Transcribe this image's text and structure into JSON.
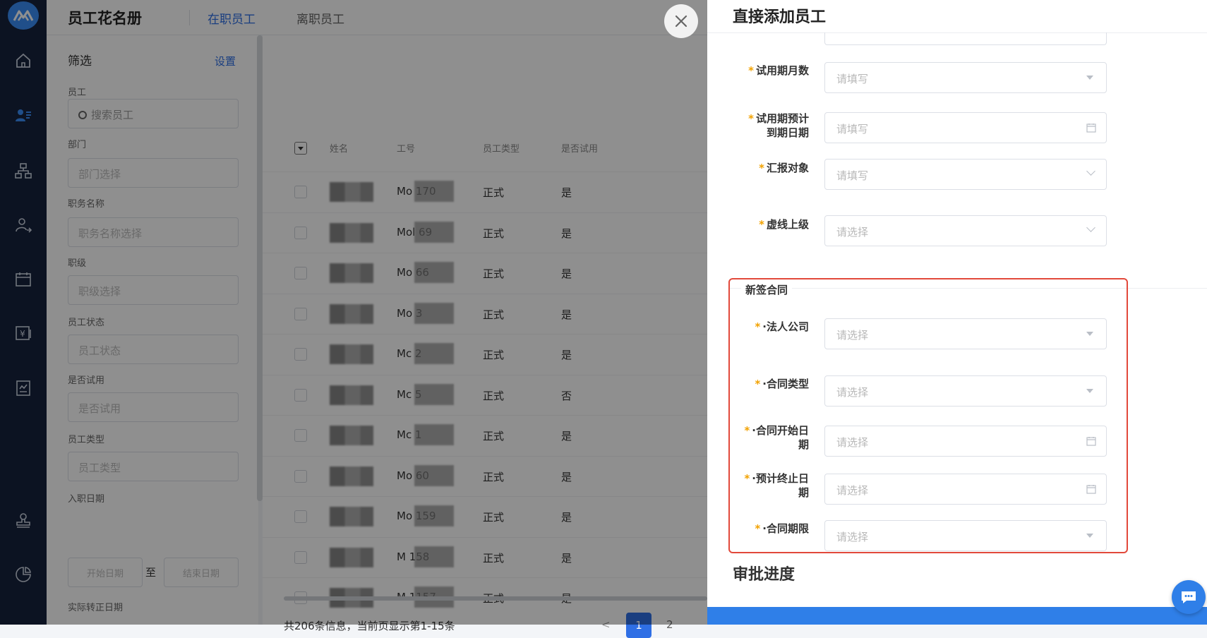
{
  "header": {
    "title": "员工花名册",
    "tabs": [
      {
        "label": "在职员工",
        "active": true
      },
      {
        "label": "离职员工",
        "active": false
      }
    ]
  },
  "filters": {
    "title": "筛选",
    "settings_label": "设置",
    "employee_label": "员工",
    "search_placeholder": "搜索员工",
    "department_label": "部门",
    "department_placeholder": "部门选择",
    "position_label": "职务名称",
    "position_placeholder": "职务名称选择",
    "level_label": "职级",
    "level_placeholder": "职级选择",
    "status_label": "员工状态",
    "status_placeholder": "员工状态",
    "probation_label": "是否试用",
    "probation_placeholder": "是否试用",
    "type_label": "员工类型",
    "type_placeholder": "员工类型",
    "hire_date_label": "入职日期",
    "start_date_placeholder": "开始日期",
    "to_label": "至",
    "end_date_placeholder": "结束日期",
    "regular_date_label": "实际转正日期"
  },
  "table": {
    "columns": [
      "姓名",
      "工号",
      "员工类型",
      "是否试用"
    ],
    "rows": [
      {
        "id": "Mo   170",
        "type": "正式",
        "probation": "是"
      },
      {
        "id": "Mol   69",
        "type": "正式",
        "probation": "是"
      },
      {
        "id": "Mo   66",
        "type": "正式",
        "probation": "是"
      },
      {
        "id": "Mo   3",
        "type": "正式",
        "probation": "是"
      },
      {
        "id": "Mc   2",
        "type": "正式",
        "probation": "是"
      },
      {
        "id": "Mc   5",
        "type": "正式",
        "probation": "否"
      },
      {
        "id": "Mc   1",
        "type": "正式",
        "probation": "是"
      },
      {
        "id": "Mo   60",
        "type": "正式",
        "probation": "是"
      },
      {
        "id": "Mo   159",
        "type": "正式",
        "probation": "是"
      },
      {
        "id": "M   158",
        "type": "正式",
        "probation": "是"
      },
      {
        "id": "M   1157",
        "type": "正式",
        "probation": "是",
        "name_suffix": "..."
      }
    ],
    "footer": "共206条信息，当前页显示第1-15条",
    "page_current": "1",
    "page_next": "2",
    "page_prev": "<"
  },
  "drawer": {
    "title": "直接添加员工",
    "fields": [
      {
        "label": "试用期月数",
        "placeholder": "请填写",
        "suffix": "caret"
      },
      {
        "label": "试用期预计到期日期",
        "label_lines": [
          "试用期预计",
          "到期日期"
        ],
        "placeholder": "请填写",
        "suffix": "calendar"
      },
      {
        "label": "汇报对象",
        "placeholder": "请填写",
        "suffix": "chevron"
      },
      {
        "label": "虚线上级",
        "placeholder": "请选择",
        "suffix": "chevron"
      }
    ],
    "contract_section_title": "新签合同",
    "contract_fields": [
      {
        "label": "·法人公司",
        "placeholder": "请选择",
        "suffix": "caret"
      },
      {
        "label": "·合同类型",
        "placeholder": "请选择",
        "suffix": "caret"
      },
      {
        "label": "·合同开始日期",
        "label_lines": [
          "·合同开始日",
          "期"
        ],
        "placeholder": "请选择",
        "suffix": "calendar"
      },
      {
        "label": "·预计终止日期",
        "label_lines": [
          "·预计终止日",
          "期"
        ],
        "placeholder": "请选择",
        "suffix": "calendar"
      },
      {
        "label": "·合同期限",
        "placeholder": "请选择",
        "suffix": "caret"
      }
    ],
    "approval_title": "审批进度",
    "required_mark": "*"
  },
  "colors": {
    "rail_bg": "#16233d",
    "accent": "#2f6fe5",
    "required_star": "#f2a200",
    "highlight_border": "#e2493b"
  },
  "icons": {
    "rail": [
      "home-icon",
      "employee-list-icon",
      "org-chart-icon",
      "user-transfer-icon",
      "calendar-icon",
      "salary-icon",
      "report-icon",
      "stamp-icon",
      "pie-chart-icon"
    ],
    "close": "close-icon",
    "chat": "chat-icon"
  }
}
